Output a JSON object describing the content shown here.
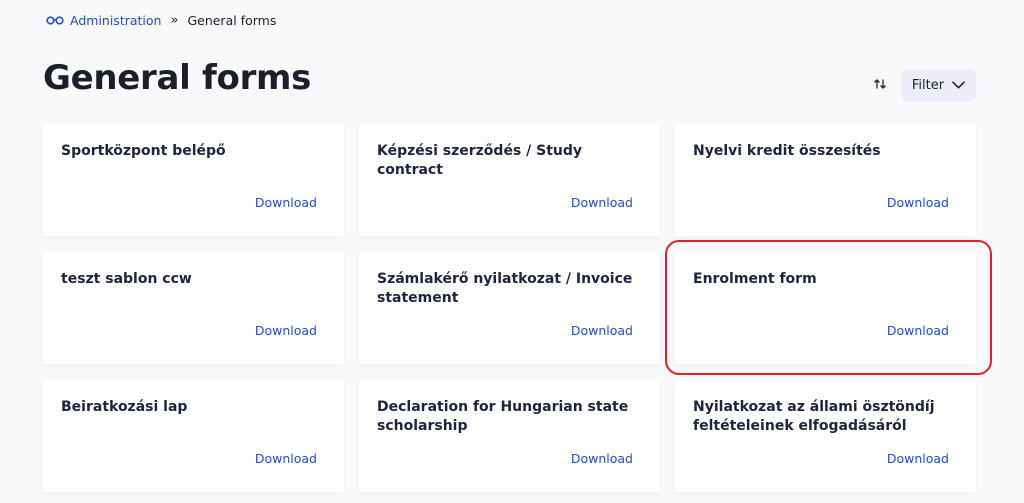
{
  "breadcrumb": {
    "icon": "glasses-icon",
    "parent": "Administration",
    "separator": "»",
    "current": "General forms"
  },
  "page": {
    "title": "General forms"
  },
  "toolbar": {
    "sort_icon": "sort-arrows-icon",
    "filter_label": "Filter",
    "filter_icon": "chevron-down-icon"
  },
  "cards": [
    {
      "title": "Sportközpont belépő",
      "action": "Download"
    },
    {
      "title": "Képzési szerződés / Study contract",
      "action": "Download"
    },
    {
      "title": "Nyelvi kredit összesítés",
      "action": "Download"
    },
    {
      "title": "teszt sablon ccw",
      "action": "Download"
    },
    {
      "title": "Számlakérő nyilatkozat / Invoice statement",
      "action": "Download"
    },
    {
      "title": "Enrolment form",
      "action": "Download"
    },
    {
      "title": "Beiratkozási lap",
      "action": "Download"
    },
    {
      "title": "Declaration for Hungarian state scholarship",
      "action": "Download"
    },
    {
      "title": "Nyilatkozat az állami ösztöndíj feltételeinek elfogadásáról",
      "action": "Download"
    }
  ],
  "highlighted_card": "Enrolment form",
  "colors": {
    "accent": "#1f4ec8",
    "highlight": "#e0222b",
    "filter_bg": "#ecedf7"
  }
}
